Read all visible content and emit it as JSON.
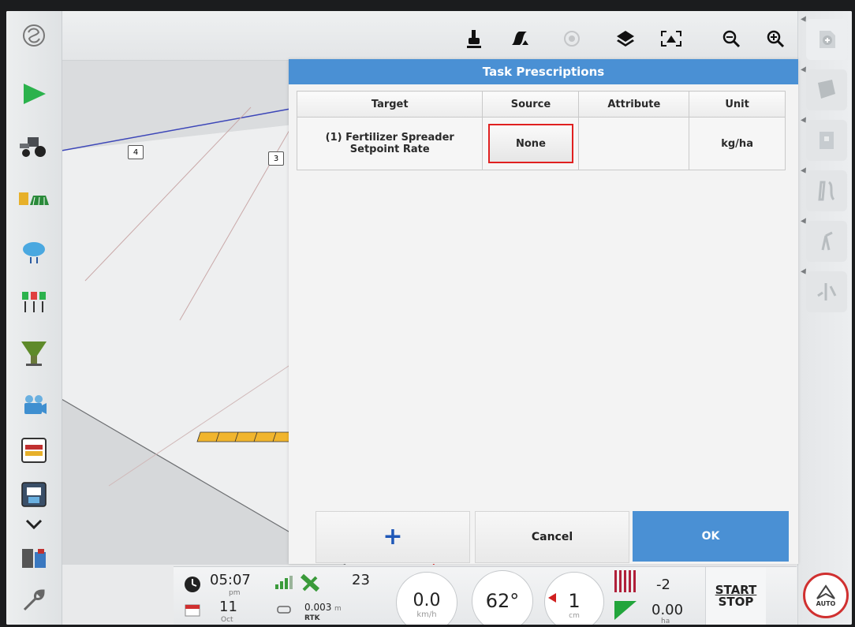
{
  "dialog": {
    "title": "Task Prescriptions",
    "columns": [
      "Target",
      "Source",
      "Attribute",
      "Unit"
    ],
    "rows": [
      {
        "target_line1": "(1) Fertilizer Spreader",
        "target_line2": "Setpoint Rate",
        "source": "None",
        "attribute": "",
        "unit": "kg/ha"
      }
    ],
    "buttons": {
      "add": "+",
      "cancel": "Cancel",
      "ok": "OK"
    }
  },
  "map": {
    "marker_left": "4",
    "marker_right": "3"
  },
  "status": {
    "time": "05:07",
    "time_suffix": "pm",
    "date_day": "11",
    "date_month": "Oct",
    "satellites": "23",
    "accuracy": "0.003",
    "accuracy_unit": "m",
    "gps_mode": "RTK",
    "speed": "0.0",
    "speed_unit": "km/h",
    "heading": "62°",
    "offset": "1",
    "offset_unit": "cm",
    "section_value": "-2",
    "area": "0.00",
    "area_unit": "ha",
    "start_stop_line1": "START",
    "start_stop_line2": "STOP",
    "auto_label": "AUTO"
  },
  "colors": {
    "accent": "#4a90d4",
    "ok_button": "#4a90d4",
    "highlight": "#e02020",
    "guidance_green": "#22a53b"
  }
}
